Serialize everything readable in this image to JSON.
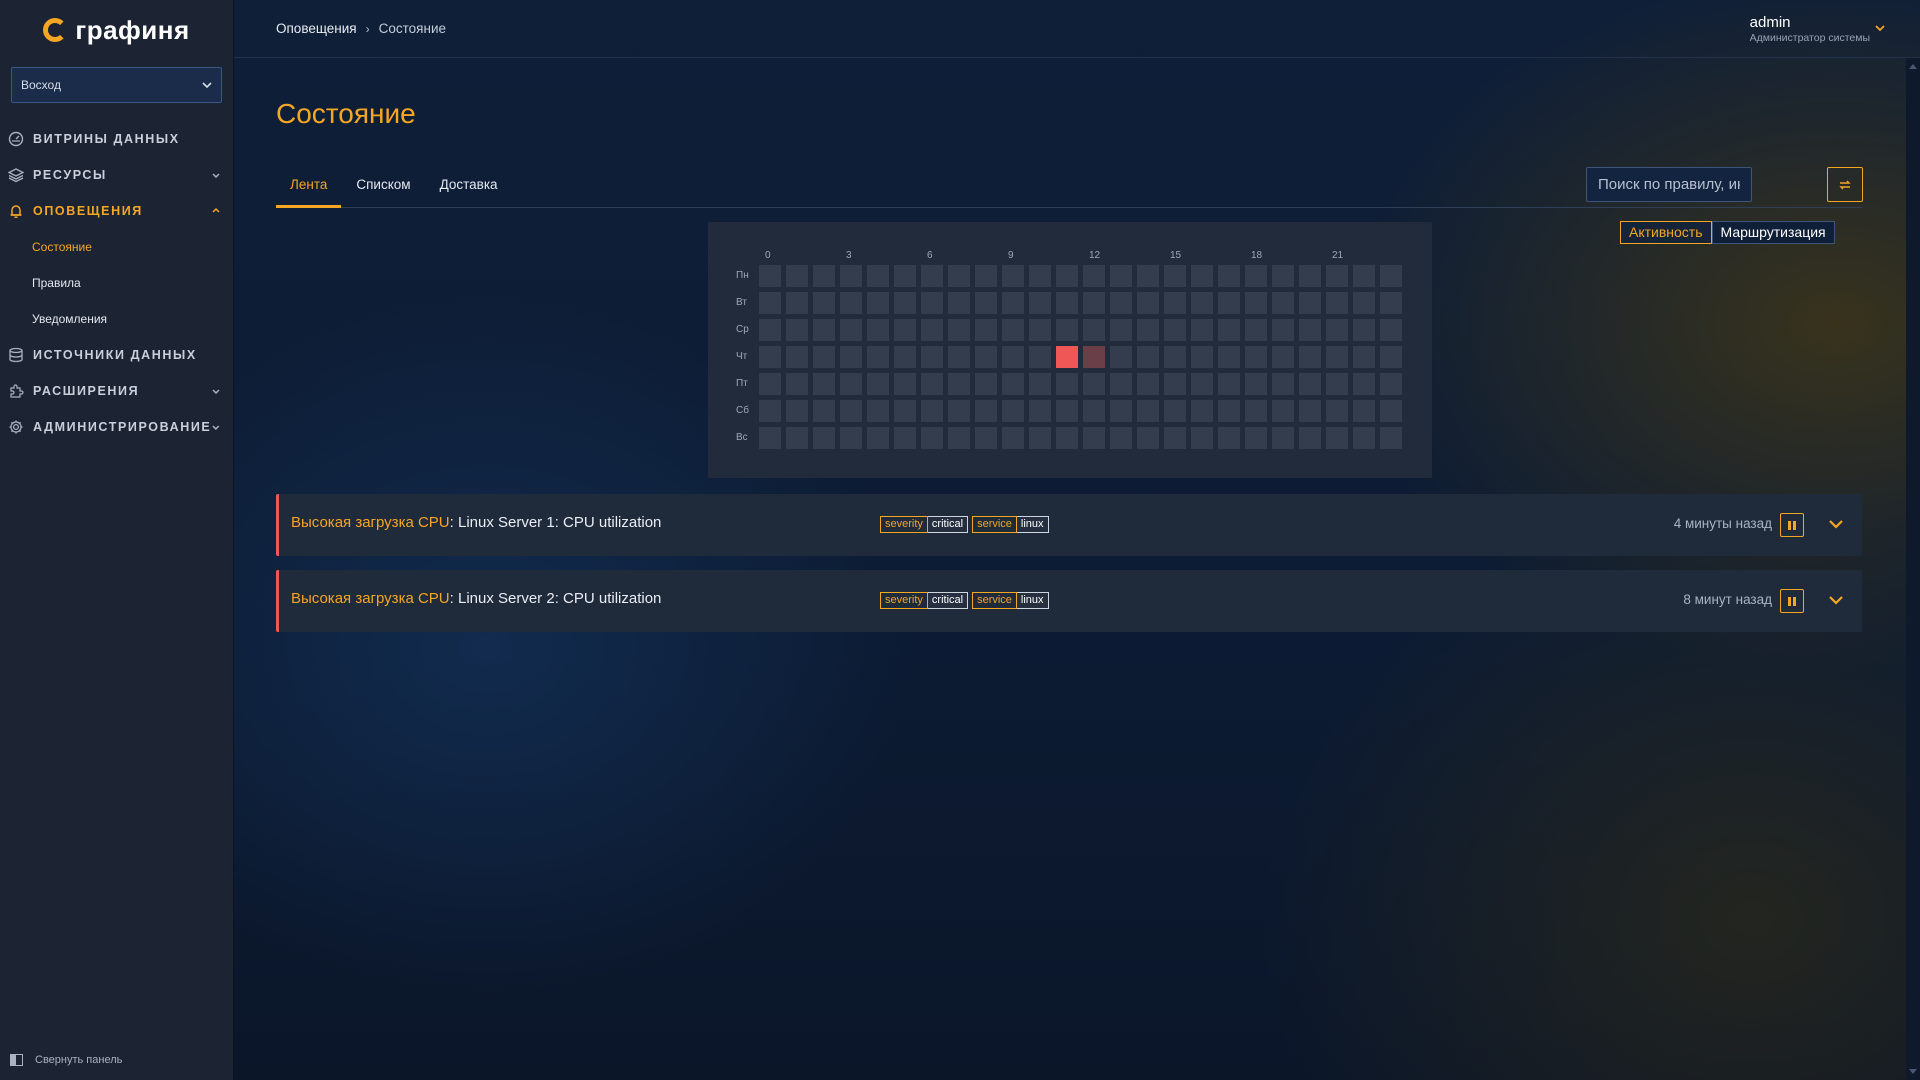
{
  "brand": {
    "name": "графиня",
    "accent": "#f5a623",
    "critical": "#ef5757"
  },
  "sidebar": {
    "org_select": "Восход",
    "items": [
      {
        "label": "ВИТРИНЫ ДАННЫХ",
        "icon": "dashboard-icon"
      },
      {
        "label": "РЕСУРСЫ",
        "icon": "layers-icon",
        "has_arrow": true
      },
      {
        "label": "ОПОВЕЩЕНИЯ",
        "icon": "bell-icon",
        "has_arrow": true,
        "expanded": true
      },
      {
        "label": "ИСТОЧНИКИ ДАННЫХ",
        "icon": "database-icon"
      },
      {
        "label": "РАСШИРЕНИЯ",
        "icon": "plugin-icon",
        "has_arrow": true
      },
      {
        "label": "АДМИНИСТРИРОВАНИЕ",
        "icon": "gear-icon",
        "has_arrow": true
      }
    ],
    "sub_items": [
      "Состояние",
      "Правила",
      "Уведомления"
    ],
    "collapse_label": "Свернуть панель"
  },
  "topbar": {
    "breadcrumb": [
      "Оповещения",
      "Состояние"
    ],
    "user_name": "admin",
    "user_role": "Администратор системы"
  },
  "page": {
    "title": "Состояние",
    "tabs": [
      "Лента",
      "Списком",
      "Доставка"
    ],
    "search_placeholder": "Поиск по правилу, инстанс",
    "toggle": [
      "Активность",
      "Маршрутизация"
    ]
  },
  "heatmap": {
    "hour_labels": [
      "0",
      "3",
      "6",
      "9",
      "12",
      "15",
      "18",
      "21"
    ],
    "day_labels": [
      "Пн",
      "Вт",
      "Ср",
      "Чт",
      "Пт",
      "Сб",
      "Вс"
    ],
    "active_cells": [
      {
        "day": "Чт",
        "hour": 11,
        "level": "high"
      },
      {
        "day": "Чт",
        "hour": 12,
        "level": "low"
      }
    ]
  },
  "alerts": [
    {
      "rule": "Высокая загрузка CPU",
      "instance": ": Linux Server 1: CPU utilization",
      "labels": [
        {
          "key": "severity",
          "value": "critical"
        },
        {
          "key": "service",
          "value": "linux"
        }
      ],
      "time": "4 минуты назад"
    },
    {
      "rule": "Высокая загрузка CPU",
      "instance": ": Linux Server 2: CPU utilization",
      "labels": [
        {
          "key": "severity",
          "value": "critical"
        },
        {
          "key": "service",
          "value": "linux"
        }
      ],
      "time": "8 минут назад"
    }
  ]
}
